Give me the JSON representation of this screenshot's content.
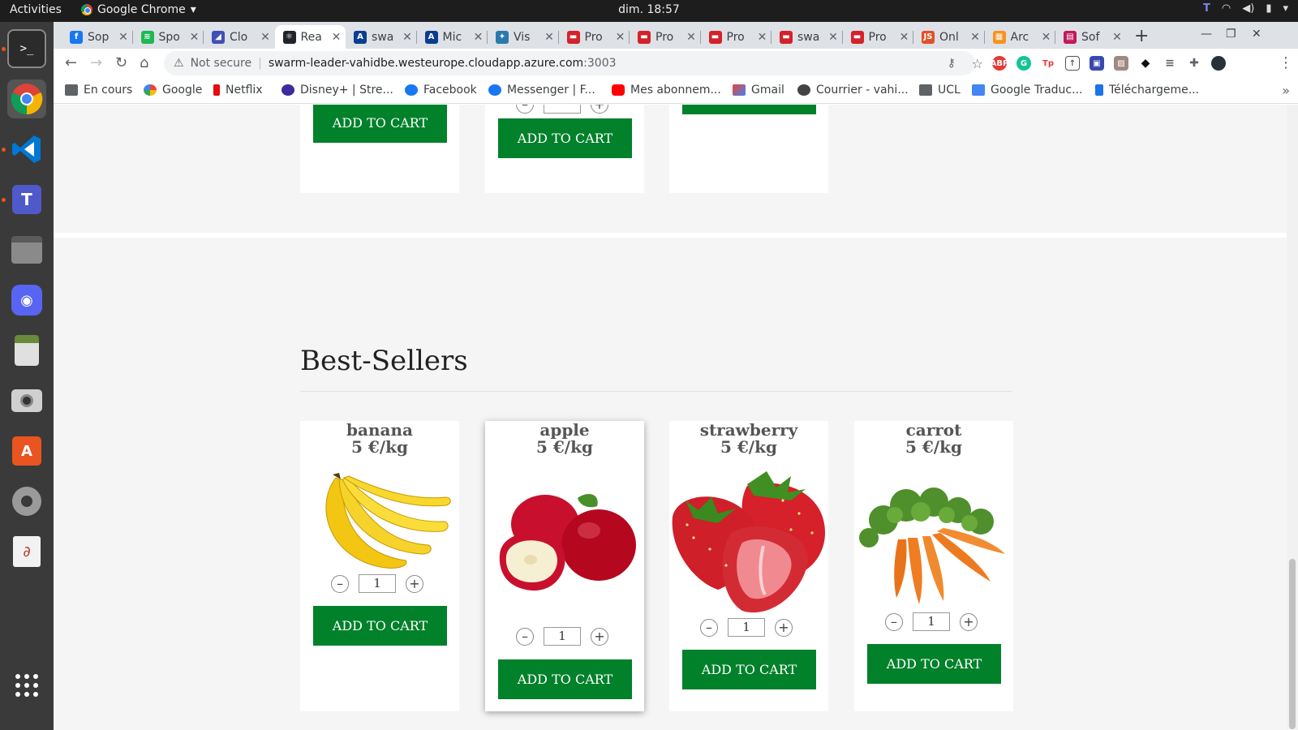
{
  "system": {
    "activities": "Activities",
    "app_name": "Google Chrome",
    "clock": "dim. 18:57"
  },
  "browser": {
    "tabs": [
      {
        "label": "Sop",
        "color": "#1877f2",
        "glyph": "f"
      },
      {
        "label": "Spo",
        "color": "#1db954",
        "glyph": "≋"
      },
      {
        "label": "Clo",
        "color": "#3f51b5",
        "glyph": "◢"
      },
      {
        "label": "Rea",
        "color": "#20232a",
        "glyph": "⚛",
        "active": true
      },
      {
        "label": "swa",
        "color": "#0b3d91",
        "glyph": "A"
      },
      {
        "label": "Mic",
        "color": "#0b3d91",
        "glyph": "A"
      },
      {
        "label": "Vis",
        "color": "#2a7ab0",
        "glyph": "✦"
      },
      {
        "label": "Pro",
        "color": "#d3222a",
        "glyph": "▬"
      },
      {
        "label": "Pro",
        "color": "#d3222a",
        "glyph": "▬"
      },
      {
        "label": "Pro",
        "color": "#d3222a",
        "glyph": "▬"
      },
      {
        "label": "swa",
        "color": "#d3222a",
        "glyph": "▬"
      },
      {
        "label": "Pro",
        "color": "#d3222a",
        "glyph": "▬"
      },
      {
        "label": "Onl",
        "color": "#e34f26",
        "glyph": "JS"
      },
      {
        "label": "Arc",
        "color": "#f7931e",
        "glyph": "▦"
      },
      {
        "label": "Sof",
        "color": "#c2185b",
        "glyph": "▤"
      }
    ],
    "address": {
      "security_label": "Not secure",
      "url": "swarm-leader-vahidbe.westeurope.cloudapp.azure.com",
      "port": ":3003"
    },
    "bookmarks": [
      {
        "label": "En cours",
        "icon": "folder-icon"
      },
      {
        "label": "Google",
        "icon": "google-icon"
      },
      {
        "label": "Netflix",
        "icon": "netflix-icon"
      },
      {
        "label": "Disney+ | Stre...",
        "icon": "disney-icon"
      },
      {
        "label": "Facebook",
        "icon": "facebook-icon"
      },
      {
        "label": "Messenger | F...",
        "icon": "facebook-icon"
      },
      {
        "label": "Mes abonnem...",
        "icon": "youtube-icon"
      },
      {
        "label": "Gmail",
        "icon": "gmail-icon"
      },
      {
        "label": "Courrier - vahi...",
        "icon": "mail-icon"
      },
      {
        "label": "UCL",
        "icon": "folder-icon"
      },
      {
        "label": "Google Traduc...",
        "icon": "translate-icon"
      },
      {
        "label": "Téléchargeme...",
        "icon": "download-icon"
      }
    ]
  },
  "page": {
    "add_to_cart_label": "ADD TO CART",
    "section_title": "Best-Sellers",
    "best_sellers": [
      {
        "name": "banana",
        "price": "5 €/kg",
        "quantity": "1",
        "image": "banana-image"
      },
      {
        "name": "apple",
        "price": "5 €/kg",
        "quantity": "1",
        "image": "apple-image"
      },
      {
        "name": "strawberry",
        "price": "5 €/kg",
        "quantity": "1",
        "image": "strawberry-image"
      },
      {
        "name": "carrot",
        "price": "5 €/kg",
        "quantity": "1",
        "image": "carrot-image"
      }
    ]
  },
  "colors": {
    "add_to_cart": "#00812a",
    "page_bg": "#f5f5f5",
    "card_text": "#555555"
  }
}
